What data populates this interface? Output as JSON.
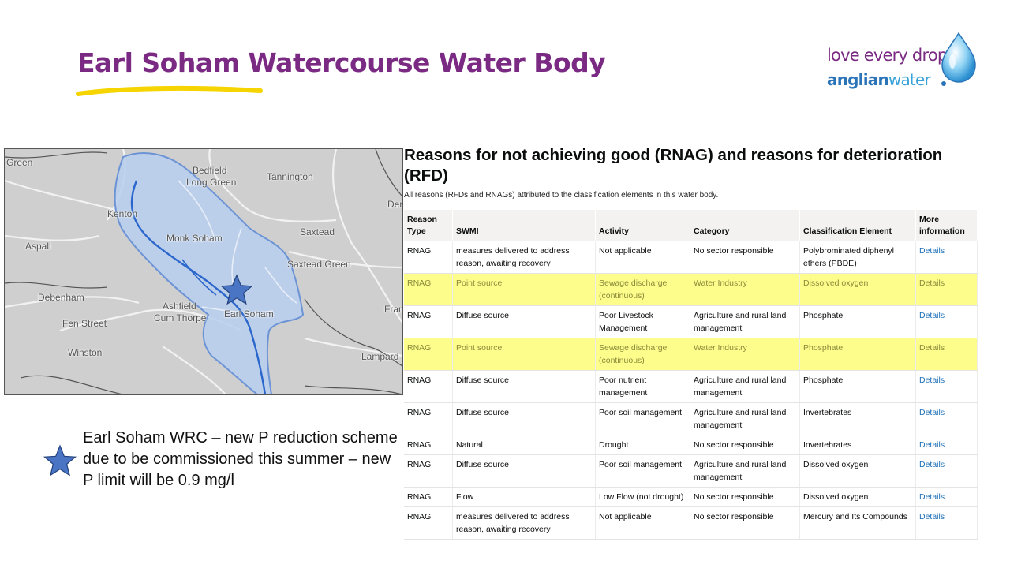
{
  "slide": {
    "title": "Earl Soham Watercourse Water Body"
  },
  "logo": {
    "line1": "love every drop",
    "line2_bold": "anglian",
    "line2_light": "water",
    "colors": {
      "purple": "#7a2a82",
      "blue": "#2b74b8",
      "light_blue": "#39a2d8"
    }
  },
  "map": {
    "places": [
      "Green",
      "Bedfield",
      "Long Green",
      "Tannington",
      "Der",
      "Kenton",
      "Monk Soham",
      "Saxtead",
      "Aspall",
      "Saxtead Green",
      "Debenham",
      "Ashfield",
      "Cum Thorpe",
      "Earl Soham",
      "Fran",
      "Fen Street",
      "Winston",
      "Lampard"
    ],
    "marker_icon": "star-icon"
  },
  "legend": {
    "icon": "star-icon",
    "text": "Earl Soham WRC – new P reduction scheme due to be commissioned this summer – new P limit will be 0.9 mg/l"
  },
  "rnag": {
    "title": "Reasons for not achieving good (RNAG) and reasons for deterioration (RFD)",
    "subtitle": "All reasons (RFDs and RNAGs) attributed to the classification elements in this water body.",
    "headers": [
      "Reason Type",
      "SWMI",
      "Activity",
      "Category",
      "Classification Element",
      "More information"
    ],
    "rows": [
      [
        "RNAG",
        "measures delivered to address reason, awaiting recovery",
        "Not applicable",
        "No sector responsible",
        "Polybrominated diphenyl ethers (PBDE)",
        "Details"
      ],
      [
        "RNAG",
        "Point source",
        "Sewage discharge (continuous)",
        "Water Industry",
        "Dissolved oxygen",
        "Details"
      ],
      [
        "RNAG",
        "Diffuse source",
        "Poor Livestock Management",
        "Agriculture and rural land management",
        "Phosphate",
        "Details"
      ],
      [
        "RNAG",
        "Point source",
        "Sewage discharge (continuous)",
        "Water Industry",
        "Phosphate",
        "Details"
      ],
      [
        "RNAG",
        "Diffuse source",
        "Poor nutrient management",
        "Agriculture and rural land management",
        "Phosphate",
        "Details"
      ],
      [
        "RNAG",
        "Diffuse source",
        "Poor soil management",
        "Agriculture and rural land management",
        "Invertebrates",
        "Details"
      ],
      [
        "RNAG",
        "Natural",
        "Drought",
        "No sector responsible",
        "Invertebrates",
        "Details"
      ],
      [
        "RNAG",
        "Diffuse source",
        "Poor soil management",
        "Agriculture and rural land management",
        "Dissolved oxygen",
        "Details"
      ],
      [
        "RNAG",
        "Flow",
        "Low Flow (not drought)",
        "No sector responsible",
        "Dissolved oxygen",
        "Details"
      ],
      [
        "RNAG",
        "measures delivered to address reason, awaiting recovery",
        "Not applicable",
        "No sector responsible",
        "Mercury and Its Compounds",
        "Details"
      ]
    ],
    "highlighted_rows": [
      1,
      3
    ],
    "highlight_color": "#fdfd8c"
  }
}
